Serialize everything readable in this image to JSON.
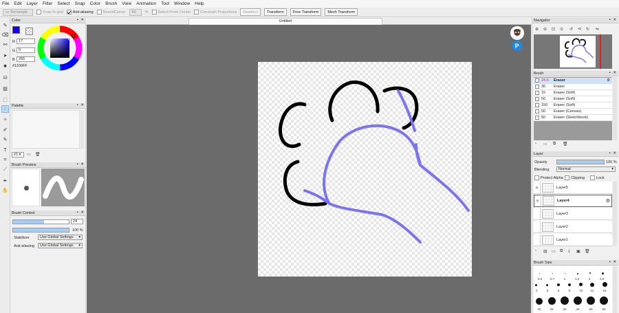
{
  "menu": [
    "File",
    "Edit",
    "Layer",
    "Filter",
    "Select",
    "Snap",
    "Color",
    "Brush",
    "View",
    "Animation",
    "Tool",
    "Window",
    "Help"
  ],
  "toolbar": {
    "shape_value": "Rectangle",
    "snap_to_grid": "Snap to grid",
    "anti_aliasing": "Anti-aliasing",
    "round_corner": "RoundCorner",
    "round_value": "60",
    "percent": "%",
    "select_from_center": "Select From Center",
    "constrain": "Constrain Proportions",
    "deselect": "Deselect",
    "transform": "Transform",
    "free_transform": "Free Transform",
    "mesh_transform": "Mesh Transform"
  },
  "document": {
    "tab_title": "Untitled"
  },
  "color_panel": {
    "title": "Color",
    "r_label": "R",
    "r_value": "17",
    "g_label": "G",
    "g_value": "0",
    "b_label": "B",
    "b_value": "255",
    "hex": "#1100FF",
    "primary": "#1100ff"
  },
  "palette_panel": {
    "title": "Palette",
    "index": "#1"
  },
  "brush_preview": {
    "title": "Brush Preview"
  },
  "brush_control": {
    "title": "Brush Control",
    "size_value": "24",
    "opacity_value": "100 %",
    "stabilizer_label": "Stabilizer",
    "stabilizer_value": "Use Global Settings",
    "antialias_label": "Anti-aliasing",
    "antialias_value": "Use Global Settings"
  },
  "navigator": {
    "title": "Navigator"
  },
  "brush_panel": {
    "title": "Brush",
    "items": [
      {
        "size": "24.6",
        "name": "Eraser"
      },
      {
        "size": "30",
        "name": "Eraser"
      },
      {
        "size": "15",
        "name": "Eraser (Soft)"
      },
      {
        "size": "50",
        "name": "Eraser (Soft)"
      },
      {
        "size": "150",
        "name": "Eraser (Soft)"
      },
      {
        "size": "50",
        "name": "Eraser (Canvas)"
      },
      {
        "size": "50",
        "name": "Eraser (Sketchbook)"
      }
    ]
  },
  "layer_panel": {
    "title": "Layer",
    "opacity_label": "Opacity",
    "opacity_value": "100 %",
    "blending_label": "Blending",
    "blending_value": "Normal",
    "protect_alpha": "Protect Alpha",
    "clipping": "Clipping",
    "lock": "Lock",
    "layers": [
      "Layer5",
      "Layer4",
      "Layer3",
      "Layer2",
      "Layer1"
    ]
  },
  "brush_size_panel": {
    "title": "Brush Size",
    "row1": [
      "0.5",
      "0.7",
      "1",
      "1.5",
      "2",
      "2.5"
    ],
    "row2": [
      "4",
      "5",
      "6",
      "8",
      "10",
      "12",
      "15"
    ],
    "row3": [
      "20",
      "25",
      "30",
      "40",
      "50",
      "60"
    ]
  },
  "colors": {
    "stroke_black": "#000000",
    "stroke_blue": "#7b73ef",
    "accent": "#bcd9f5"
  }
}
